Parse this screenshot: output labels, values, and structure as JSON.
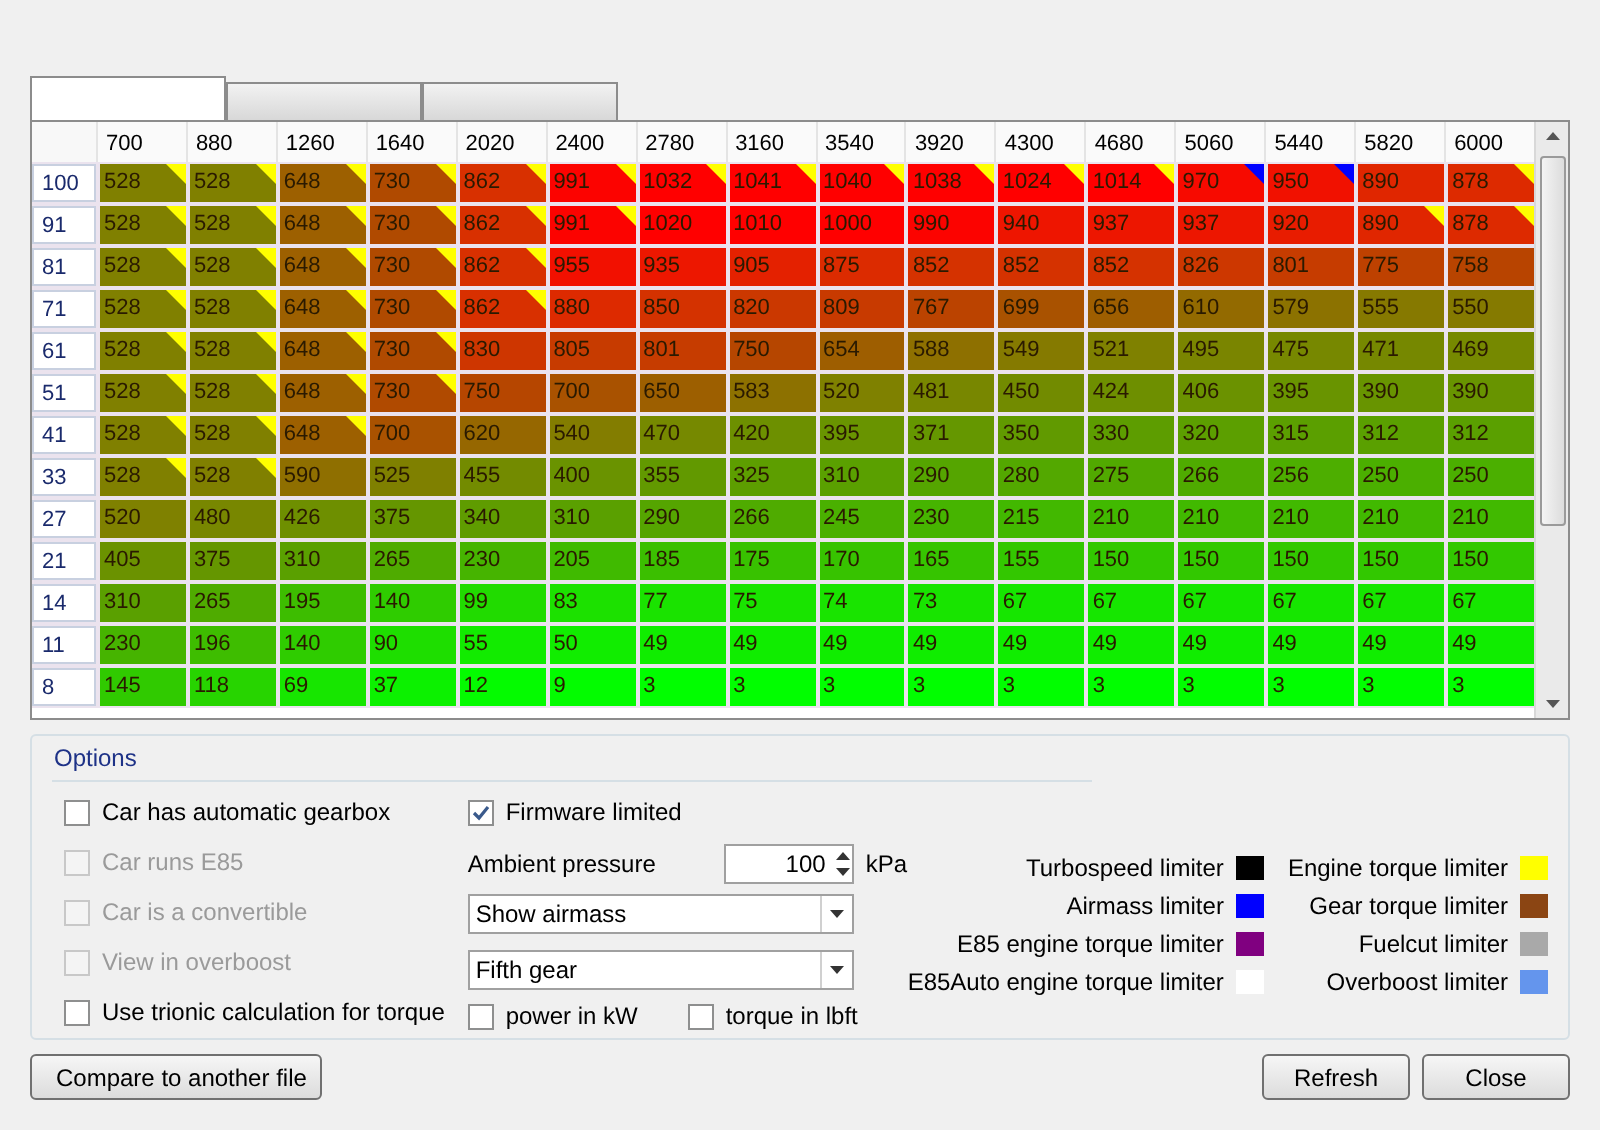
{
  "tabs": [
    {
      "selected": true
    },
    {
      "selected": false
    },
    {
      "selected": false
    }
  ],
  "table": {
    "columns": [
      "700",
      "880",
      "1260",
      "1640",
      "2020",
      "2400",
      "2780",
      "3160",
      "3540",
      "3920",
      "4300",
      "4680",
      "5060",
      "5440",
      "5820",
      "6000"
    ],
    "rows": [
      {
        "label": "100",
        "cells": [
          {
            "value": "528",
            "color": "#ffff00"
          },
          {
            "value": "528",
            "color": "#ffff00"
          },
          {
            "value": "648",
            "color": "#ffff00"
          },
          {
            "value": "730",
            "color": "#ffff00"
          },
          {
            "value": "862",
            "color": "#ffff00"
          },
          {
            "value": "991",
            "color": "#ffff00"
          },
          {
            "value": "1032",
            "color": "#ffff00"
          },
          {
            "value": "1041",
            "color": "#ffff00"
          },
          {
            "value": "1040",
            "color": "#ffff00"
          },
          {
            "value": "1038",
            "color": "#ffff00"
          },
          {
            "value": "1024",
            "color": "#ffff00"
          },
          {
            "value": "1014",
            "color": "#ffff00"
          },
          {
            "value": "970",
            "color": "#0000ff"
          },
          {
            "value": "950",
            "color": "#0000ff"
          },
          {
            "value": "890"
          },
          {
            "value": "878",
            "color": "#ffff00"
          }
        ]
      },
      {
        "label": "91",
        "cells": [
          {
            "value": "528",
            "color": "#ffff00"
          },
          {
            "value": "528",
            "color": "#ffff00"
          },
          {
            "value": "648",
            "color": "#ffff00"
          },
          {
            "value": "730",
            "color": "#ffff00"
          },
          {
            "value": "862",
            "color": "#ffff00"
          },
          {
            "value": "991",
            "color": "#ffff00"
          },
          {
            "value": "1020"
          },
          {
            "value": "1010"
          },
          {
            "value": "1000"
          },
          {
            "value": "990"
          },
          {
            "value": "940"
          },
          {
            "value": "937"
          },
          {
            "value": "937"
          },
          {
            "value": "920"
          },
          {
            "value": "890",
            "color": "#ffff00"
          },
          {
            "value": "878",
            "color": "#ffff00"
          }
        ]
      },
      {
        "label": "81",
        "cells": [
          {
            "value": "528",
            "color": "#ffff00"
          },
          {
            "value": "528",
            "color": "#ffff00"
          },
          {
            "value": "648",
            "color": "#ffff00"
          },
          {
            "value": "730",
            "color": "#ffff00"
          },
          {
            "value": "862",
            "color": "#ffff00"
          },
          {
            "value": "955"
          },
          {
            "value": "935"
          },
          {
            "value": "905"
          },
          {
            "value": "875"
          },
          {
            "value": "852"
          },
          {
            "value": "852"
          },
          {
            "value": "852"
          },
          {
            "value": "826"
          },
          {
            "value": "801"
          },
          {
            "value": "775"
          },
          {
            "value": "758"
          }
        ]
      },
      {
        "label": "71",
        "cells": [
          {
            "value": "528",
            "color": "#ffff00"
          },
          {
            "value": "528",
            "color": "#ffff00"
          },
          {
            "value": "648",
            "color": "#ffff00"
          },
          {
            "value": "730",
            "color": "#ffff00"
          },
          {
            "value": "862",
            "color": "#ffff00"
          },
          {
            "value": "880"
          },
          {
            "value": "850"
          },
          {
            "value": "820"
          },
          {
            "value": "809"
          },
          {
            "value": "767"
          },
          {
            "value": "699"
          },
          {
            "value": "656"
          },
          {
            "value": "610"
          },
          {
            "value": "579"
          },
          {
            "value": "555"
          },
          {
            "value": "550"
          }
        ]
      },
      {
        "label": "61",
        "cells": [
          {
            "value": "528",
            "color": "#ffff00"
          },
          {
            "value": "528",
            "color": "#ffff00"
          },
          {
            "value": "648",
            "color": "#ffff00"
          },
          {
            "value": "730",
            "color": "#ffff00"
          },
          {
            "value": "830"
          },
          {
            "value": "805"
          },
          {
            "value": "801"
          },
          {
            "value": "750"
          },
          {
            "value": "654"
          },
          {
            "value": "588"
          },
          {
            "value": "549"
          },
          {
            "value": "521"
          },
          {
            "value": "495"
          },
          {
            "value": "475"
          },
          {
            "value": "471"
          },
          {
            "value": "469"
          }
        ]
      },
      {
        "label": "51",
        "cells": [
          {
            "value": "528",
            "color": "#ffff00"
          },
          {
            "value": "528",
            "color": "#ffff00"
          },
          {
            "value": "648",
            "color": "#ffff00"
          },
          {
            "value": "730",
            "color": "#ffff00"
          },
          {
            "value": "750"
          },
          {
            "value": "700"
          },
          {
            "value": "650"
          },
          {
            "value": "583"
          },
          {
            "value": "520"
          },
          {
            "value": "481"
          },
          {
            "value": "450"
          },
          {
            "value": "424"
          },
          {
            "value": "406"
          },
          {
            "value": "395"
          },
          {
            "value": "390"
          },
          {
            "value": "390"
          }
        ]
      },
      {
        "label": "41",
        "cells": [
          {
            "value": "528",
            "color": "#ffff00"
          },
          {
            "value": "528",
            "color": "#ffff00"
          },
          {
            "value": "648",
            "color": "#ffff00"
          },
          {
            "value": "700"
          },
          {
            "value": "620"
          },
          {
            "value": "540"
          },
          {
            "value": "470"
          },
          {
            "value": "420"
          },
          {
            "value": "395"
          },
          {
            "value": "371"
          },
          {
            "value": "350"
          },
          {
            "value": "330"
          },
          {
            "value": "320"
          },
          {
            "value": "315"
          },
          {
            "value": "312"
          },
          {
            "value": "312"
          }
        ]
      },
      {
        "label": "33",
        "cells": [
          {
            "value": "528",
            "color": "#ffff00"
          },
          {
            "value": "528",
            "color": "#ffff00"
          },
          {
            "value": "590"
          },
          {
            "value": "525"
          },
          {
            "value": "455"
          },
          {
            "value": "400"
          },
          {
            "value": "355"
          },
          {
            "value": "325"
          },
          {
            "value": "310"
          },
          {
            "value": "290"
          },
          {
            "value": "280"
          },
          {
            "value": "275"
          },
          {
            "value": "266"
          },
          {
            "value": "256"
          },
          {
            "value": "250"
          },
          {
            "value": "250"
          }
        ]
      },
      {
        "label": "27",
        "cells": [
          {
            "value": "520"
          },
          {
            "value": "480"
          },
          {
            "value": "426"
          },
          {
            "value": "375"
          },
          {
            "value": "340"
          },
          {
            "value": "310"
          },
          {
            "value": "290"
          },
          {
            "value": "266"
          },
          {
            "value": "245"
          },
          {
            "value": "230"
          },
          {
            "value": "215"
          },
          {
            "value": "210"
          },
          {
            "value": "210"
          },
          {
            "value": "210"
          },
          {
            "value": "210"
          },
          {
            "value": "210"
          }
        ]
      },
      {
        "label": "21",
        "cells": [
          {
            "value": "405"
          },
          {
            "value": "375"
          },
          {
            "value": "310"
          },
          {
            "value": "265"
          },
          {
            "value": "230"
          },
          {
            "value": "205"
          },
          {
            "value": "185"
          },
          {
            "value": "175"
          },
          {
            "value": "170"
          },
          {
            "value": "165"
          },
          {
            "value": "155"
          },
          {
            "value": "150"
          },
          {
            "value": "150"
          },
          {
            "value": "150"
          },
          {
            "value": "150"
          },
          {
            "value": "150"
          }
        ]
      },
      {
        "label": "14",
        "cells": [
          {
            "value": "310"
          },
          {
            "value": "265"
          },
          {
            "value": "195"
          },
          {
            "value": "140"
          },
          {
            "value": "99"
          },
          {
            "value": "83"
          },
          {
            "value": "77"
          },
          {
            "value": "75"
          },
          {
            "value": "74"
          },
          {
            "value": "73"
          },
          {
            "value": "67"
          },
          {
            "value": "67"
          },
          {
            "value": "67"
          },
          {
            "value": "67"
          },
          {
            "value": "67"
          },
          {
            "value": "67"
          }
        ]
      },
      {
        "label": "11",
        "cells": [
          {
            "value": "230"
          },
          {
            "value": "196"
          },
          {
            "value": "140"
          },
          {
            "value": "90"
          },
          {
            "value": "55"
          },
          {
            "value": "50"
          },
          {
            "value": "49"
          },
          {
            "value": "49"
          },
          {
            "value": "49"
          },
          {
            "value": "49"
          },
          {
            "value": "49"
          },
          {
            "value": "49"
          },
          {
            "value": "49"
          },
          {
            "value": "49"
          },
          {
            "value": "49"
          },
          {
            "value": "49"
          }
        ]
      },
      {
        "label": "8",
        "cells": [
          {
            "value": "145"
          },
          {
            "value": "118"
          },
          {
            "value": "69"
          },
          {
            "value": "37"
          },
          {
            "value": "12"
          },
          {
            "value": "9"
          },
          {
            "value": "3"
          },
          {
            "value": "3"
          },
          {
            "value": "3"
          },
          {
            "value": "3"
          },
          {
            "value": "3"
          },
          {
            "value": "3"
          },
          {
            "value": "3"
          },
          {
            "value": "3"
          },
          {
            "value": "3"
          },
          {
            "value": "3"
          }
        ]
      }
    ]
  },
  "options": {
    "title": "Options",
    "left_checkboxes": [
      {
        "label": "Car has automatic gearbox",
        "checked": false,
        "disabled": false
      },
      {
        "label": "Car runs E85",
        "checked": false,
        "disabled": true
      },
      {
        "label": "Car is a convertible",
        "checked": false,
        "disabled": true
      },
      {
        "label": "View in overboost",
        "checked": false,
        "disabled": true
      },
      {
        "label": "Use trionic calculation for torque",
        "checked": false,
        "disabled": false
      }
    ],
    "firmware_limited": {
      "label": "Firmware limited",
      "checked": true
    },
    "ambient_pressure": {
      "label": "Ambient pressure",
      "value": "100",
      "unit": "kPa"
    },
    "dropdowns": [
      {
        "value": "Show airmass"
      },
      {
        "value": "Fifth gear"
      }
    ],
    "unit_checkboxes": [
      {
        "label": "power in kW",
        "checked": false
      },
      {
        "label": "torque in lbft",
        "checked": false
      }
    ],
    "legend_left": [
      {
        "label": "Turbospeed limiter",
        "color": "#000000"
      },
      {
        "label": "Airmass limiter",
        "color": "#0000ff"
      },
      {
        "label": "E85 engine torque limiter",
        "color": "#800080"
      },
      {
        "label": "E85Auto engine torque limiter",
        "color": "#ffffff"
      }
    ],
    "legend_right": [
      {
        "label": "Engine torque limiter",
        "color": "#ffff00"
      },
      {
        "label": "Gear torque limiter",
        "color": "#8b4513"
      },
      {
        "label": "Fuelcut limiter",
        "color": "#a9a9a9"
      },
      {
        "label": "Overboost limiter",
        "color": "#6495ed"
      }
    ]
  },
  "buttons": {
    "compare": "Compare to another file",
    "refresh": "Refresh",
    "close": "Close"
  }
}
